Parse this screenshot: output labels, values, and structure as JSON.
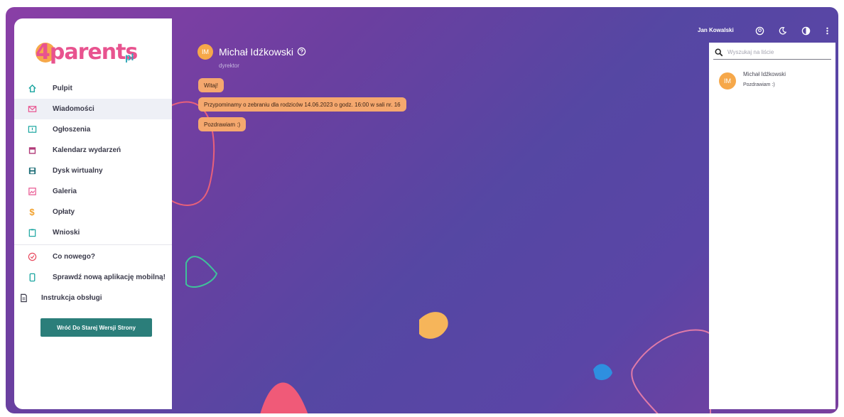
{
  "app": {
    "logo_text": "4parents",
    "logo_suffix": "pl"
  },
  "sidebar": {
    "items": [
      {
        "label": "Pulpit",
        "icon": "home-icon",
        "active": false
      },
      {
        "label": "Wiadomości",
        "icon": "mail-icon",
        "active": true
      },
      {
        "label": "Ogłoszenia",
        "icon": "announcement-icon",
        "active": false
      },
      {
        "label": "Kalendarz wydarzeń",
        "icon": "calendar-icon",
        "active": false
      },
      {
        "label": "Dysk wirtualny",
        "icon": "disk-icon",
        "active": false
      },
      {
        "label": "Galeria",
        "icon": "gallery-icon",
        "active": false
      },
      {
        "label": "Opłaty",
        "icon": "dollar-icon",
        "active": false
      },
      {
        "label": "Wnioski",
        "icon": "clipboard-icon",
        "active": false
      }
    ],
    "extra_items": [
      {
        "label": "Co nowego?",
        "icon": "whats-new-icon"
      },
      {
        "label": "Sprawdź nową aplikację mobilną!",
        "icon": "phone-icon"
      },
      {
        "label": "Instrukcja obsługi",
        "icon": "document-icon"
      }
    ],
    "old_version_button": "Wróć Do Starej Wersji Strony"
  },
  "conversation": {
    "avatar_initials": "IM",
    "name": "Michał Idźkowski",
    "role": "dyrektor",
    "messages": [
      "Witaj!",
      "Przypominamy o zebraniu dla rodziców 14.06.2023 o godz. 16:00 w sali nr. 16",
      "Pozdrawiam :)"
    ]
  },
  "topbar": {
    "user_name": "Jan Kowalski"
  },
  "right_panel": {
    "search_placeholder": "Wyszukaj na liście",
    "contacts": [
      {
        "initials": "IM",
        "name": "Michał Idźkowski",
        "last_message": "Pozdrawiam :)"
      }
    ]
  },
  "colors": {
    "accent": "#f5a86e",
    "brand_pink": "#e8538f",
    "brand_teal": "#2b7e7a",
    "background": "#5f43a3",
    "icon_teal": "#1aa5a0"
  }
}
